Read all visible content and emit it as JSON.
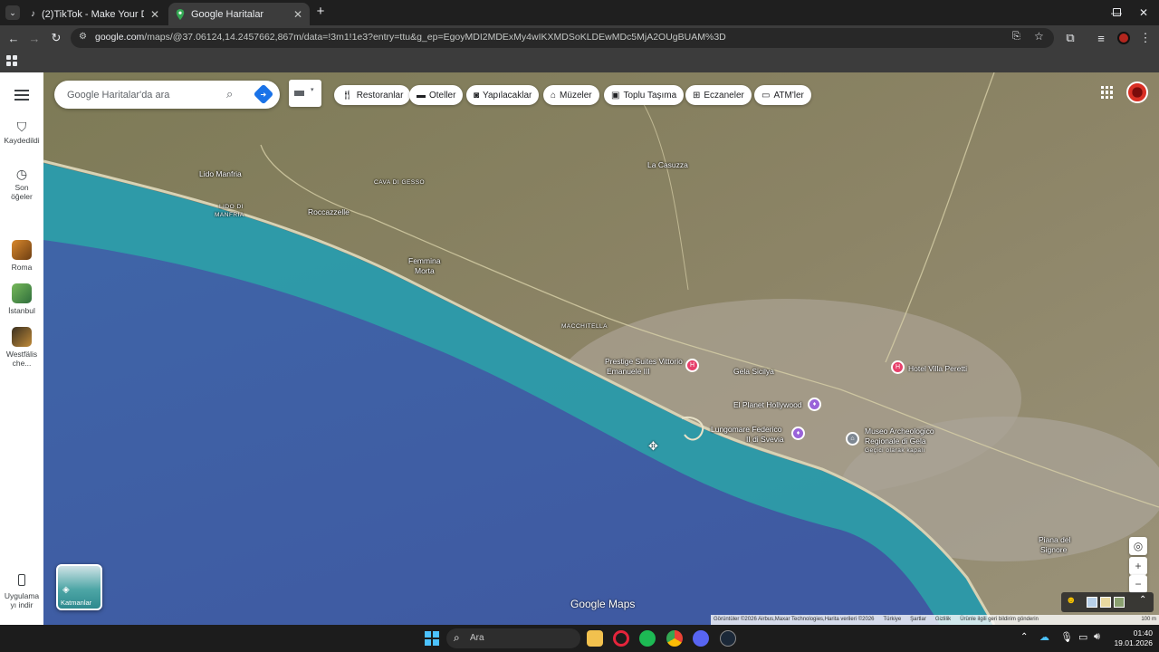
{
  "browser": {
    "tabs": [
      {
        "label": "(2)TikTok - Make Your Day",
        "active": false
      },
      {
        "label": "Google Haritalar",
        "active": true
      }
    ],
    "url_host": "google.com",
    "url_path": "/maps/@37.06124,14.2457662,867m/data=!3m1!1e3?entry=ttu&g_ep=EgoyMDI2MDExMy4wIKXMDSoKLDEwMDc5MjA2OUgBUAM%3D"
  },
  "rail": {
    "saved_label": "Kaydedildi",
    "recent_line1": "Son",
    "recent_line2": "öğeler",
    "places": [
      {
        "label": "Roma"
      },
      {
        "label": "İstanbul"
      },
      {
        "label_line1": "Westfälis",
        "label_line2": "che..."
      }
    ],
    "app_line1": "Uygulama",
    "app_line2": "yı indir"
  },
  "search": {
    "placeholder": "Google Haritalar'da ara"
  },
  "chips": [
    {
      "label": "Restoranlar",
      "icon": "fork-knife-icon"
    },
    {
      "label": "Oteller",
      "icon": "bed-icon"
    },
    {
      "label": "Yapılacaklar",
      "icon": "camera-icon"
    },
    {
      "label": "Müzeler",
      "icon": "museum-icon"
    },
    {
      "label": "Toplu Taşıma",
      "icon": "bus-icon"
    },
    {
      "label": "Eczaneler",
      "icon": "pharmacy-icon"
    },
    {
      "label": "ATM'ler",
      "icon": "atm-icon"
    }
  ],
  "map_labels": {
    "lido_manfria": "Lido Manfria",
    "lido_manfria_small_1": "LIDO DI",
    "lido_manfria_small_2": "MANFRIA",
    "cava_di_gesso": "CAVA DI GESSO",
    "roccazzelle": "Roccazzelle",
    "femmina_1": "Femmina",
    "femmina_2": "Morta",
    "macchitella": "MACCHITELLA",
    "la_casuzza": "La Casuzza",
    "gela": "Gela Sicilya",
    "prestige_1": "Prestige Suites Vittorio",
    "prestige_2": "Emanuele III",
    "planet": "El Planet Hollywood",
    "lungomare_1": "Lungomare Federico",
    "lungomare_2": "II di Svevia",
    "museo_1": "Museo Archeologico",
    "museo_2": "Regionale di Gela",
    "museo_3": "Geçici olarak kapalı",
    "hotel": "Hotel Villa Peretti",
    "piana_1": "Piana del",
    "piana_2": "Signore"
  },
  "layers_label": "Katmanlar",
  "watermark": "Google Maps",
  "attribution": "Görüntüler ©2026 Airbus,Maxar Technologies,Harita verileri ©2026",
  "footer_links": [
    "Türkiye",
    "Şartlar",
    "Gizlilik",
    "Ürünle ilgili geri bildirim gönderin"
  ],
  "scale": "100 m",
  "taskbar": {
    "search_label": "Ara",
    "time": "01:40",
    "date": "19.01.2026"
  }
}
